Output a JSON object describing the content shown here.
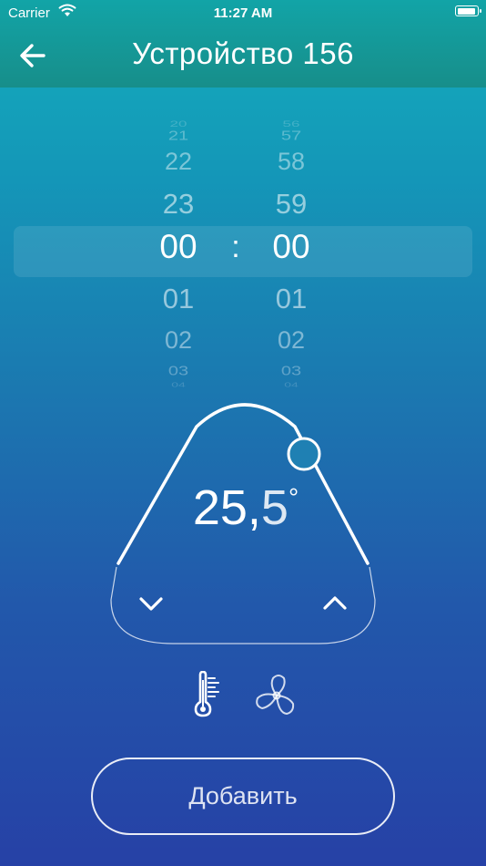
{
  "status_bar": {
    "carrier": "Carrier",
    "time": "11:27 AM"
  },
  "header": {
    "title": "Устройство 156",
    "back_icon": "arrow-left-icon"
  },
  "time_picker": {
    "hours": [
      "20",
      "21",
      "22",
      "23",
      "00",
      "01",
      "02",
      "03",
      "04"
    ],
    "minutes": [
      "56",
      "57",
      "58",
      "59",
      "00",
      "01",
      "02",
      "03",
      "04"
    ],
    "selected_hour": "00",
    "selected_minute": "00",
    "separator": ":"
  },
  "thermostat": {
    "value_int": "25,",
    "value_dec": "5",
    "degree": "°",
    "down_icon": "chevron-down-icon",
    "up_icon": "chevron-up-icon"
  },
  "modes": {
    "icons": [
      "thermometer-icon",
      "fan-icon"
    ]
  },
  "actions": {
    "add_label": "Добавить"
  },
  "colors": {
    "header": "#169a98",
    "bg_top": "#15aebc",
    "bg_bottom": "#2641a6"
  }
}
